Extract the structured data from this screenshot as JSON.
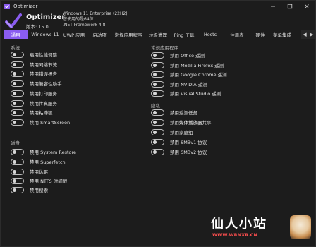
{
  "window": {
    "title": "Optimizer"
  },
  "header": {
    "app_name": "Optimizer",
    "version": "版本: 15.0",
    "sysinfo": [
      "Windows 11 Enterprise (22H2)",
      "您使用的是64位",
      ".NET Framework 4.8"
    ]
  },
  "tabs": [
    "通用",
    "Windows 11",
    "UWP 应用",
    "启动项",
    "常规应用程序",
    "垃圾清理",
    "Ping 工具",
    "Hosts",
    "注册表",
    "硬件",
    "菜单集成"
  ],
  "tab_arrows": [
    "◀",
    "▶"
  ],
  "left_sections": [
    {
      "title": "系统",
      "items": [
        "启用性能调整",
        "禁用网络节流",
        "禁用错误报告",
        "禁用兼容性助手",
        "禁用打印服务",
        "禁用传真服务",
        "禁用粘滞键",
        "禁用 SmartScreen"
      ]
    },
    {
      "title": "磁盘",
      "items": [
        "禁用 System Restore",
        "禁用 Superfetch",
        "禁用休眠",
        "禁用 NTFS 时间戳",
        "禁用搜索"
      ]
    }
  ],
  "right_sections": [
    {
      "title": "常规应用程序",
      "items": [
        "禁用 Office 遥测",
        "禁用 Mozilla Firefox 遥测",
        "禁用 Google Chrome 遥测",
        "禁用 NVIDIA 遥测",
        "禁用 Visual Studio 遥测"
      ]
    },
    {
      "title": "隐私",
      "items": [
        "禁用遥测任务",
        "禁用媒体播放器共享",
        "禁用家庭组",
        "禁用 SMBv1 协议",
        "禁用 SMBv2 协议"
      ]
    }
  ],
  "watermark": {
    "title": "仙人小站",
    "url": "WWW.WRNXR.CN"
  },
  "colors": {
    "accent": "#8a5cf0",
    "background": "#1c1c1c",
    "text": "#e6e6e6"
  }
}
